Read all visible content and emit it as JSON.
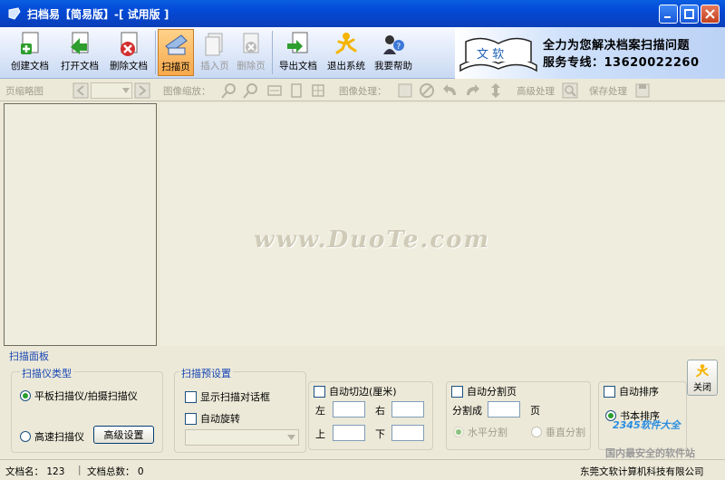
{
  "window": {
    "title": "扫档易【简易版】-[ 试用版 ]"
  },
  "toolbar": {
    "buttons": [
      {
        "label": "创建文档",
        "icon": "new-doc-icon"
      },
      {
        "label": "打开文档",
        "icon": "open-doc-icon"
      },
      {
        "label": "删除文档",
        "icon": "delete-doc-icon"
      },
      {
        "label": "扫描页",
        "icon": "scan-page-icon"
      },
      {
        "label": "插入页",
        "icon": "insert-page-icon"
      },
      {
        "label": "删除页",
        "icon": "delete-page-icon"
      },
      {
        "label": "导出文档",
        "icon": "export-doc-icon"
      },
      {
        "label": "退出系统",
        "icon": "exit-icon"
      },
      {
        "label": "我要帮助",
        "icon": "help-icon"
      }
    ]
  },
  "banner": {
    "logo_text": "文 软",
    "line1": "全力为您解决档案扫描问题",
    "line2": "服务专线：13620022260"
  },
  "toolbar2": {
    "thumb_label": "页缩略图",
    "zoom_label": "图像缩放：",
    "process_label": "图像处理：",
    "advanced_label": "高级处理",
    "save_label": "保存处理"
  },
  "canvas": {
    "watermark": "www.DuoTe.com"
  },
  "scan_panel": {
    "title": "扫描面板",
    "scanner_type": {
      "title": "扫描仪类型",
      "option_flatbed": "平板扫描仪/拍摄扫描仪",
      "option_fast": "高速扫描仪",
      "advanced_button": "高级设置"
    },
    "preset": {
      "title": "扫描预设置",
      "show_dialog": "显示扫描对话框",
      "auto_rotate": "自动旋转"
    },
    "auto_cut": {
      "label": "自动切边(厘米)",
      "left": "左",
      "right": "右",
      "top": "上",
      "bottom": "下"
    },
    "auto_split": {
      "label": "自动分割页",
      "split_into": "分割成",
      "page_unit": "页",
      "horizontal": "水平分割",
      "vertical": "垂直分割"
    },
    "auto_sort": {
      "label": "自动排序",
      "book_sort": "书本排序"
    },
    "close_button": "关闭"
  },
  "overlay": {
    "site_badge": "2345软件大全",
    "site_sub": "国内最安全的软件站"
  },
  "status": {
    "doc_name": "文档名： 123",
    "doc_total": "文档总数： 0",
    "company": "东莞文软计算机科技有限公司"
  }
}
